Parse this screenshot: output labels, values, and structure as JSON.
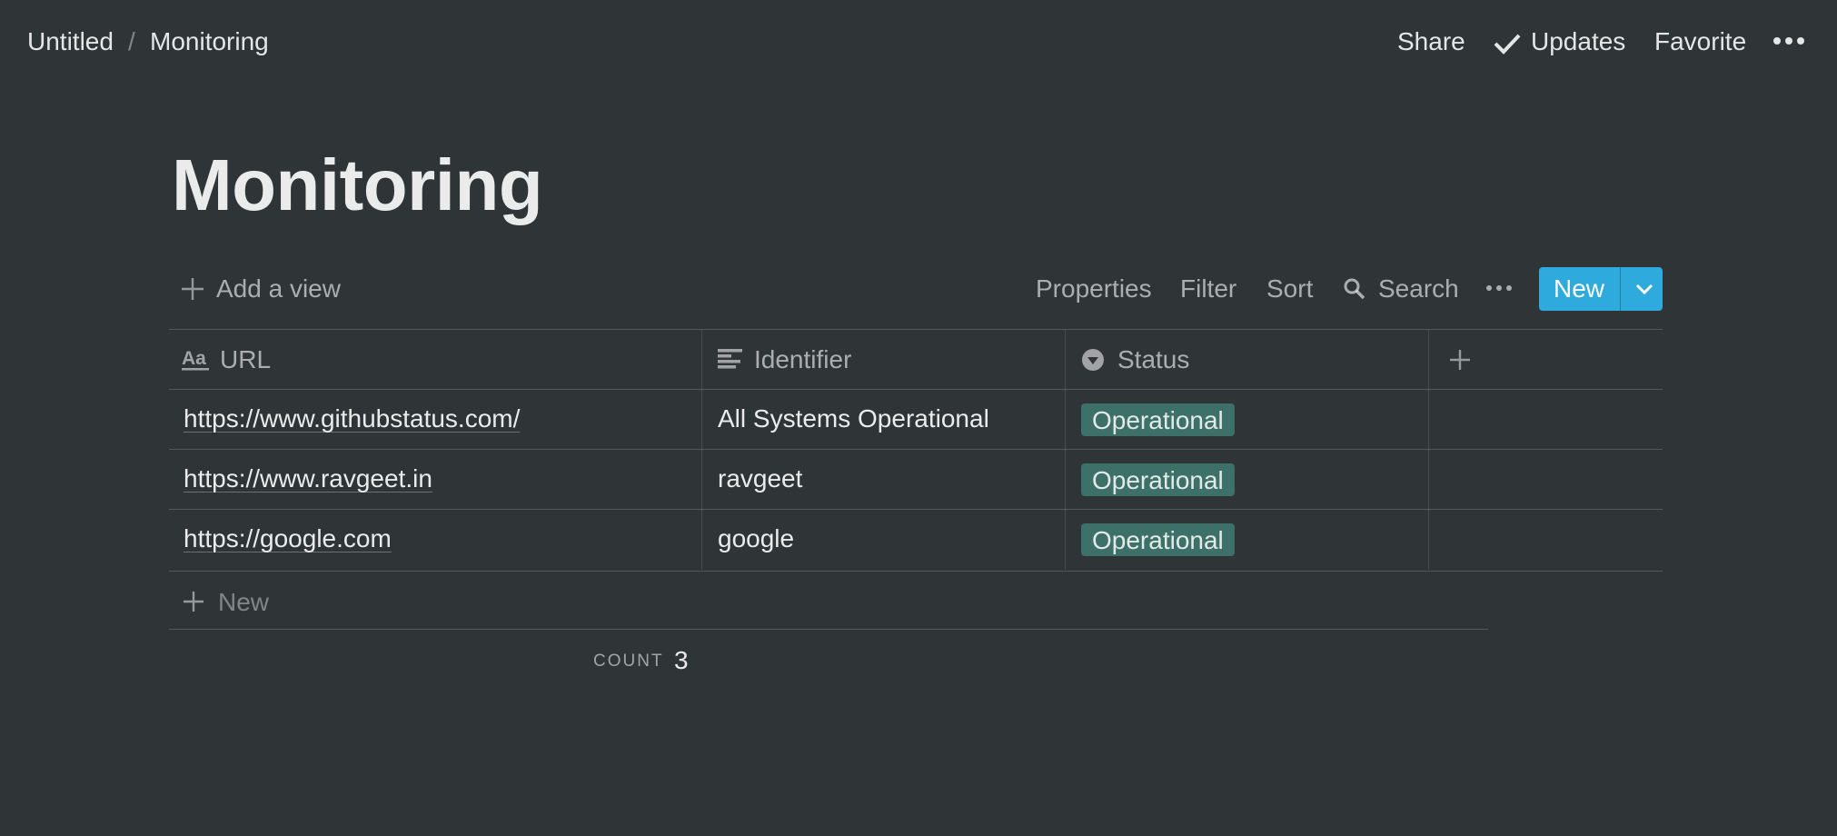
{
  "breadcrumb": {
    "parent": "Untitled",
    "separator": "/",
    "current": "Monitoring"
  },
  "topbar": {
    "share": "Share",
    "updates": "Updates",
    "favorite": "Favorite"
  },
  "page": {
    "title": "Monitoring"
  },
  "toolbar": {
    "add_view": "Add a view",
    "properties": "Properties",
    "filter": "Filter",
    "sort": "Sort",
    "search": "Search",
    "new": "New"
  },
  "table": {
    "columns": [
      {
        "label": "URL",
        "icon": "text-aa-icon"
      },
      {
        "label": "Identifier",
        "icon": "lines-icon"
      },
      {
        "label": "Status",
        "icon": "select-icon"
      }
    ],
    "rows": [
      {
        "url": "https://www.githubstatus.com/",
        "identifier": "All Systems Operational",
        "status": "Operational"
      },
      {
        "url": "https://www.ravgeet.in",
        "identifier": "ravgeet",
        "status": "Operational"
      },
      {
        "url": "https://google.com",
        "identifier": "google",
        "status": "Operational"
      }
    ],
    "new_row": "New",
    "count_label": "COUNT",
    "count_value": "3"
  },
  "colors": {
    "background": "#2f3437",
    "accent": "#2eaadc",
    "status_operational": "#3d7068"
  }
}
